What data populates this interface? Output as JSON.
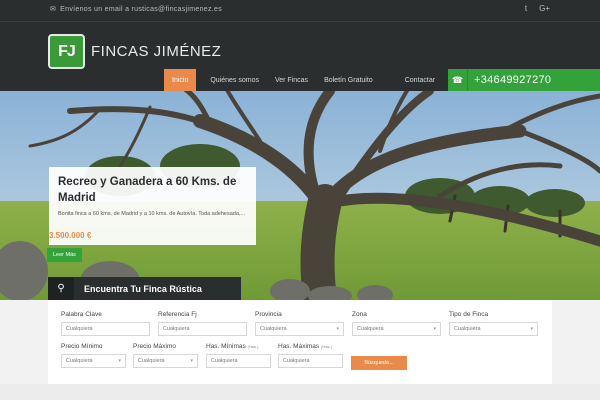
{
  "topbar": {
    "email_text": "Envíenos un email a rusticas@fincasjimenez.es",
    "social": [
      "twitter-icon",
      "google-plus-icon"
    ],
    "social_labels": [
      "t",
      "G+"
    ]
  },
  "brand": {
    "logo_text": "FJ",
    "name": "FINCAS JIMÉNEZ"
  },
  "nav": {
    "items": [
      {
        "label": "Inicio"
      },
      {
        "label": "Quiénes somos"
      },
      {
        "label": "Ver Fincas"
      },
      {
        "label": "Boletín Gratuito"
      },
      {
        "label": "Contactar"
      }
    ],
    "phone": "+34649927270"
  },
  "colors": {
    "accent": "#e98a4a",
    "green": "#34a23b",
    "dark": "#2b2e2f"
  },
  "hero": {
    "title": "Recreo y Ganadera a 60 Kms. de Madrid",
    "description": "Bonita finca a 60 kms. de Madrid y a 10 kms. de Autovía. Toda adehesada,...",
    "price": "3.500.000 €",
    "more_label": "Leer Más",
    "search_tab_label": "Encuentra Tu Finca Rústica"
  },
  "form": {
    "keyword": {
      "label": "Palabra Clave",
      "placeholder": "Cualquiera"
    },
    "reference": {
      "label": "Referencia Fj",
      "placeholder": "Cualquiera"
    },
    "province": {
      "label": "Provincia",
      "value": "Cualquiera"
    },
    "zone": {
      "label": "Zona",
      "value": "Cualquiera"
    },
    "type": {
      "label": "Tipo de Finca",
      "value": "Cualquiera"
    },
    "min_price": {
      "label": "Precio Mínimo",
      "value": "Cualquiera"
    },
    "max_price": {
      "label": "Precio Máximo",
      "value": "Cualquiera"
    },
    "min_ha": {
      "label": "Has. Mínimas",
      "unit": "(Has.)",
      "placeholder": "Cualquiera"
    },
    "max_ha": {
      "label": "Has. Máximas",
      "unit": "(Has.)",
      "placeholder": "Cualquiera"
    },
    "submit_label": "Búsqueda..."
  }
}
